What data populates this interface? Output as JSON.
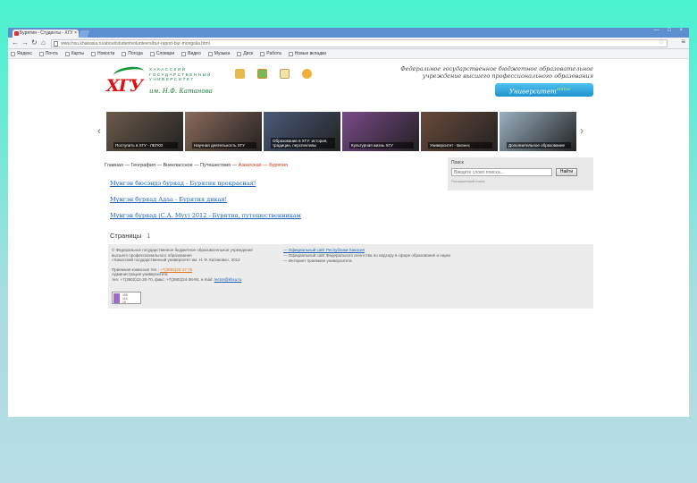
{
  "browser": {
    "tab_title": "Бурятия - Студенты - ХГУ",
    "tab_close": "×",
    "window_controls": "— □ ×",
    "url": "www.hsu.khakasia.ru/about/studentvolunteers/bur-raport-bur-mongolia.html",
    "bookmarks": [
      "Яндекс",
      "Почта",
      "Карты",
      "Новости",
      "Погода",
      "Словари",
      "Видео",
      "Музыка",
      "Диск",
      "Работа",
      "Новые вкладки"
    ]
  },
  "header": {
    "logo_letters": "ХГУ",
    "logo_text": [
      "ХАКАССКИЙ",
      "ГОСУДАРСТВЕННЫЙ",
      "УНИВЕРСИТЕТ"
    ],
    "logo_sign": "им. Н.Ф. Катанова",
    "tagline": "Федеральное государственное бюджетное образовательное учреждение высшего профессионального образования",
    "univ_button": "Университет",
    "univ_button_sup": "online"
  },
  "slider": {
    "left_arrow": "‹",
    "right_arrow": "›",
    "slides": [
      {
        "caption": "Поступить в ХГУ - ЛЕГКО",
        "color": "#6b5a4a"
      },
      {
        "caption": "Научная деятельность ХГУ",
        "color": "#8b6a5a"
      },
      {
        "caption": "Образование в ХГУ: история, традиции, перспективы",
        "color": "#4a5a7a"
      },
      {
        "caption": "Культурная жизнь ХГУ",
        "color": "#7a4a8a"
      },
      {
        "caption": "Университет - Бизнес",
        "color": "#6a4a3a"
      },
      {
        "caption": "Дополнительное образование",
        "color": "#9ab0c0"
      }
    ]
  },
  "breadcrumb": {
    "trail": "Главная — География — Внеклассное — Путешествия —",
    "current": "Азиатская — Бурятия"
  },
  "content": {
    "links": [
      "Мунгэн бюсэндэ буряад - Бурятия прекрасная!",
      "Мунгэн буряад Адаа - Бурятия дикая!",
      "Мунгэн буряад (С.А. Муу) 2012 - Бурятия, путешественникам"
    ],
    "pages_label": "Страницы",
    "pages_number": "1"
  },
  "search": {
    "label": "Поиск",
    "placeholder": "Введите слово поиска...",
    "button": "Найти",
    "hint": "Расширенный поиск"
  },
  "footer": {
    "left_lines": [
      "© Федеральное государственное бюджетное образовательное учреждение",
      "высшего профессионального образования",
      "«Хакасский государственный университет им. Н. Ф. Катанова», 2012"
    ],
    "address_label": "Приемная комиссия тел.:",
    "address_link": "+7(3902)22-47-75",
    "address_line2": "Администрация университета",
    "address_line3": "тел. +7(3902)22-30-70, факс: +7(3902)24-38-84, e-mail:",
    "email": "rector@khsu.ru",
    "right_links": [
      "— Официальный сайт Республики Хакасия",
      "— Официальный сайт Федерального агентства по надзору в сфере образования и науки",
      "— Интернет приемная университета"
    ],
    "counter_lines": [
      "155",
      "116",
      "19"
    ]
  }
}
